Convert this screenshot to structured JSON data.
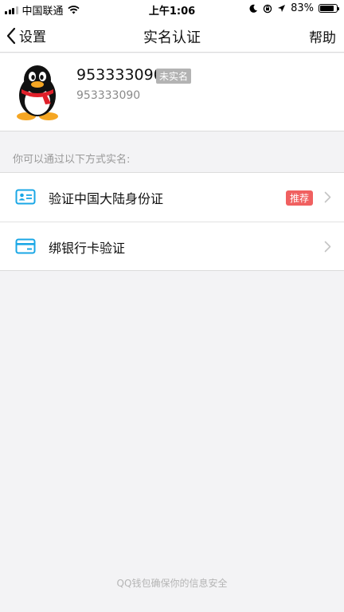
{
  "status_bar": {
    "carrier": "中国联通",
    "time": "上午1:06",
    "battery_percent": "83%",
    "battery_level": 0.83
  },
  "nav": {
    "back_label": "设置",
    "title": "实名认证",
    "help_label": "帮助"
  },
  "profile": {
    "name": "953333090",
    "badge": "未实名",
    "id": "953333090"
  },
  "section_hint": "你可以通过以下方式实名:",
  "methods": [
    {
      "label": "验证中国大陆身份证",
      "tag": "推荐",
      "icon": "id-card-icon"
    },
    {
      "label": "绑银行卡验证",
      "tag": "",
      "icon": "bank-card-icon"
    }
  ],
  "footer": "QQ钱包确保你的信息安全",
  "colors": {
    "accent_blue": "#1aa7e6",
    "tag_red": "#f06060",
    "badge_gray": "#b3b3b3"
  }
}
